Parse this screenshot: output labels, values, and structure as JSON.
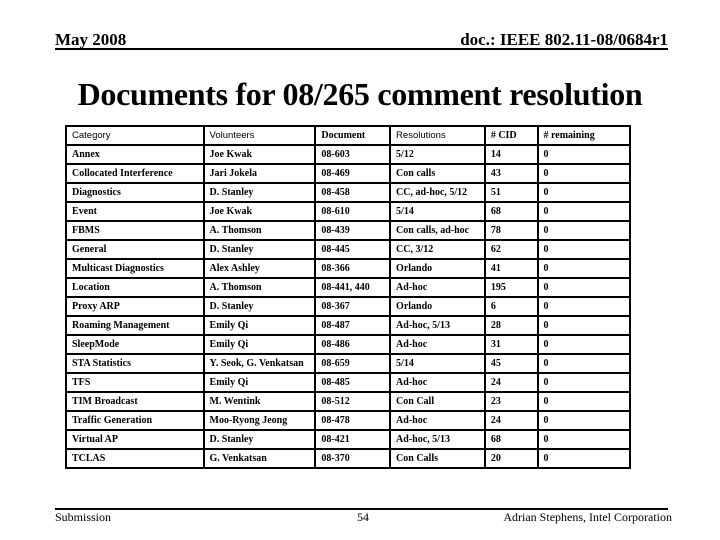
{
  "header": {
    "date": "May 2008",
    "doc_id": "doc.: IEEE 802.11-08/0684r1"
  },
  "title": "Documents for 08/265 comment resolution",
  "table": {
    "columns": [
      "Category",
      "Volunteers",
      "Document",
      "Resolutions",
      "# CID",
      "# remaining"
    ],
    "rows": [
      [
        "Annex",
        "Joe Kwak",
        "08-603",
        "5/12",
        "14",
        "0"
      ],
      [
        "Collocated Interference",
        "Jari Jokela",
        "08-469",
        "Con calls",
        "43",
        "0"
      ],
      [
        "Diagnostics",
        "D. Stanley",
        "08-458",
        "CC, ad-hoc, 5/12",
        "51",
        "0"
      ],
      [
        "Event",
        "Joe Kwak",
        "08-610",
        "5/14",
        "68",
        "0"
      ],
      [
        "FBMS",
        "A. Thomson",
        "08-439",
        "Con calls, ad-hoc",
        "78",
        "0"
      ],
      [
        "General",
        "D. Stanley",
        "08-445",
        "CC, 3/12",
        "62",
        "0"
      ],
      [
        "Multicast Diagnostics",
        "Alex Ashley",
        "08-366",
        "Orlando",
        "41",
        "0"
      ],
      [
        "Location",
        "A. Thomson",
        "08-441, 440",
        "Ad-hoc",
        "195",
        "0"
      ],
      [
        "Proxy ARP",
        "D. Stanley",
        "08-367",
        "Orlando",
        "6",
        "0"
      ],
      [
        "Roaming Management",
        "Emily Qi",
        "08-487",
        "Ad-hoc, 5/13",
        "28",
        "0"
      ],
      [
        "SleepMode",
        "Emily Qi",
        "08-486",
        "Ad-hoc",
        "31",
        "0"
      ],
      [
        "STA Statistics",
        "Y. Seok, G. Venkatsan",
        "08-659",
        "5/14",
        "45",
        "0"
      ],
      [
        "TFS",
        "Emily Qi",
        "08-485",
        "Ad-hoc",
        "24",
        "0"
      ],
      [
        "TIM Broadcast",
        "M. Wentink",
        "08-512",
        "Con Call",
        "23",
        "0"
      ],
      [
        "Traffic Generation",
        "Moo-Ryong Jeong",
        "08-478",
        "Ad-hoc",
        "24",
        "0"
      ],
      [
        "Virtual AP",
        "D. Stanley",
        "08-421",
        "Ad-hoc, 5/13",
        "68",
        "0"
      ],
      [
        "TCLAS",
        "G. Venkatsan",
        "08-370",
        "Con Calls",
        "20",
        "0"
      ]
    ]
  },
  "footer": {
    "left": "Submission",
    "page": "54",
    "author": "Adrian Stephens, Intel Corporation"
  }
}
